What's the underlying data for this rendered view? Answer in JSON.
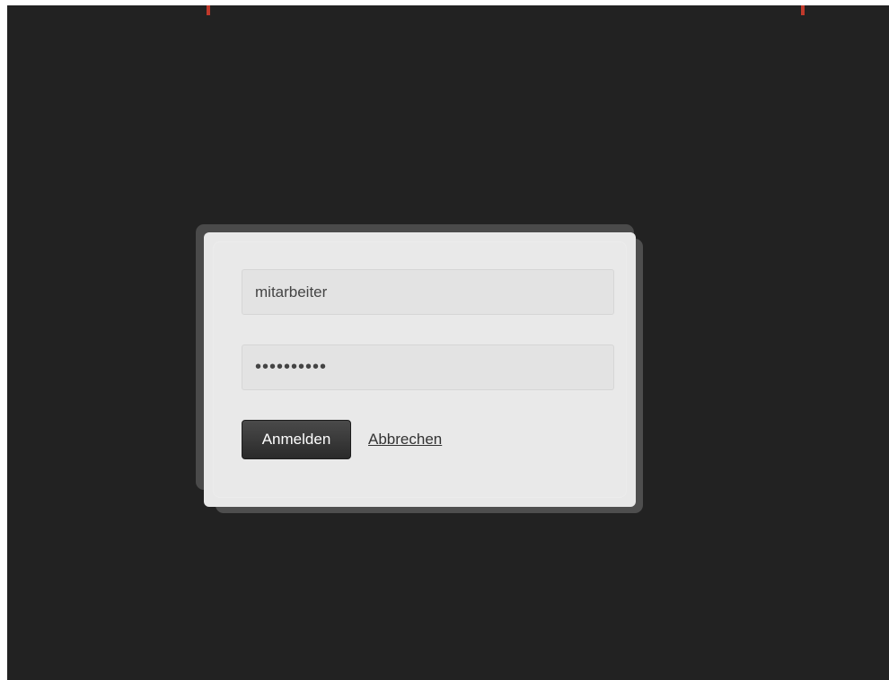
{
  "login": {
    "username_value": "mitarbeiter",
    "password_value": "••••••••••",
    "submit_label": "Anmelden",
    "cancel_label": "Abbrechen"
  },
  "colors": {
    "background": "#222222",
    "dialog": "#e8e8e8",
    "accent": "#c0392b",
    "button": "#333333"
  }
}
